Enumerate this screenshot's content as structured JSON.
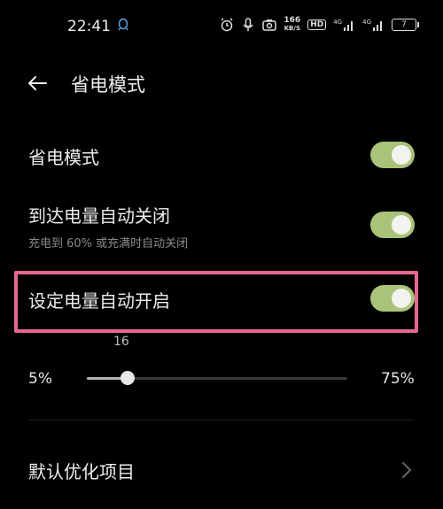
{
  "status_bar": {
    "time": "22:41",
    "net_speed_value": "166",
    "net_speed_unit": "KB/S",
    "hd_label": "HD",
    "signal1_label": "4G",
    "signal2_label": "4G",
    "battery_level": "7"
  },
  "header": {
    "title": "省电模式"
  },
  "settings": {
    "power_saving": {
      "label": "省电模式",
      "enabled": true
    },
    "auto_close": {
      "label": "到达电量自动关闭",
      "subtitle": "充电到 60% 或充满时自动关闭",
      "enabled": true
    },
    "auto_open": {
      "label": "设定电量自动开启",
      "enabled": true
    }
  },
  "slider": {
    "value": "16",
    "min_label": "5%",
    "max_label": "75%",
    "min": 5,
    "max": 75,
    "current": 16
  },
  "optimize": {
    "label": "默认优化项目"
  },
  "colors": {
    "toggle_on": "#a9c47a",
    "highlight": "#e6688e",
    "background": "#000000"
  }
}
